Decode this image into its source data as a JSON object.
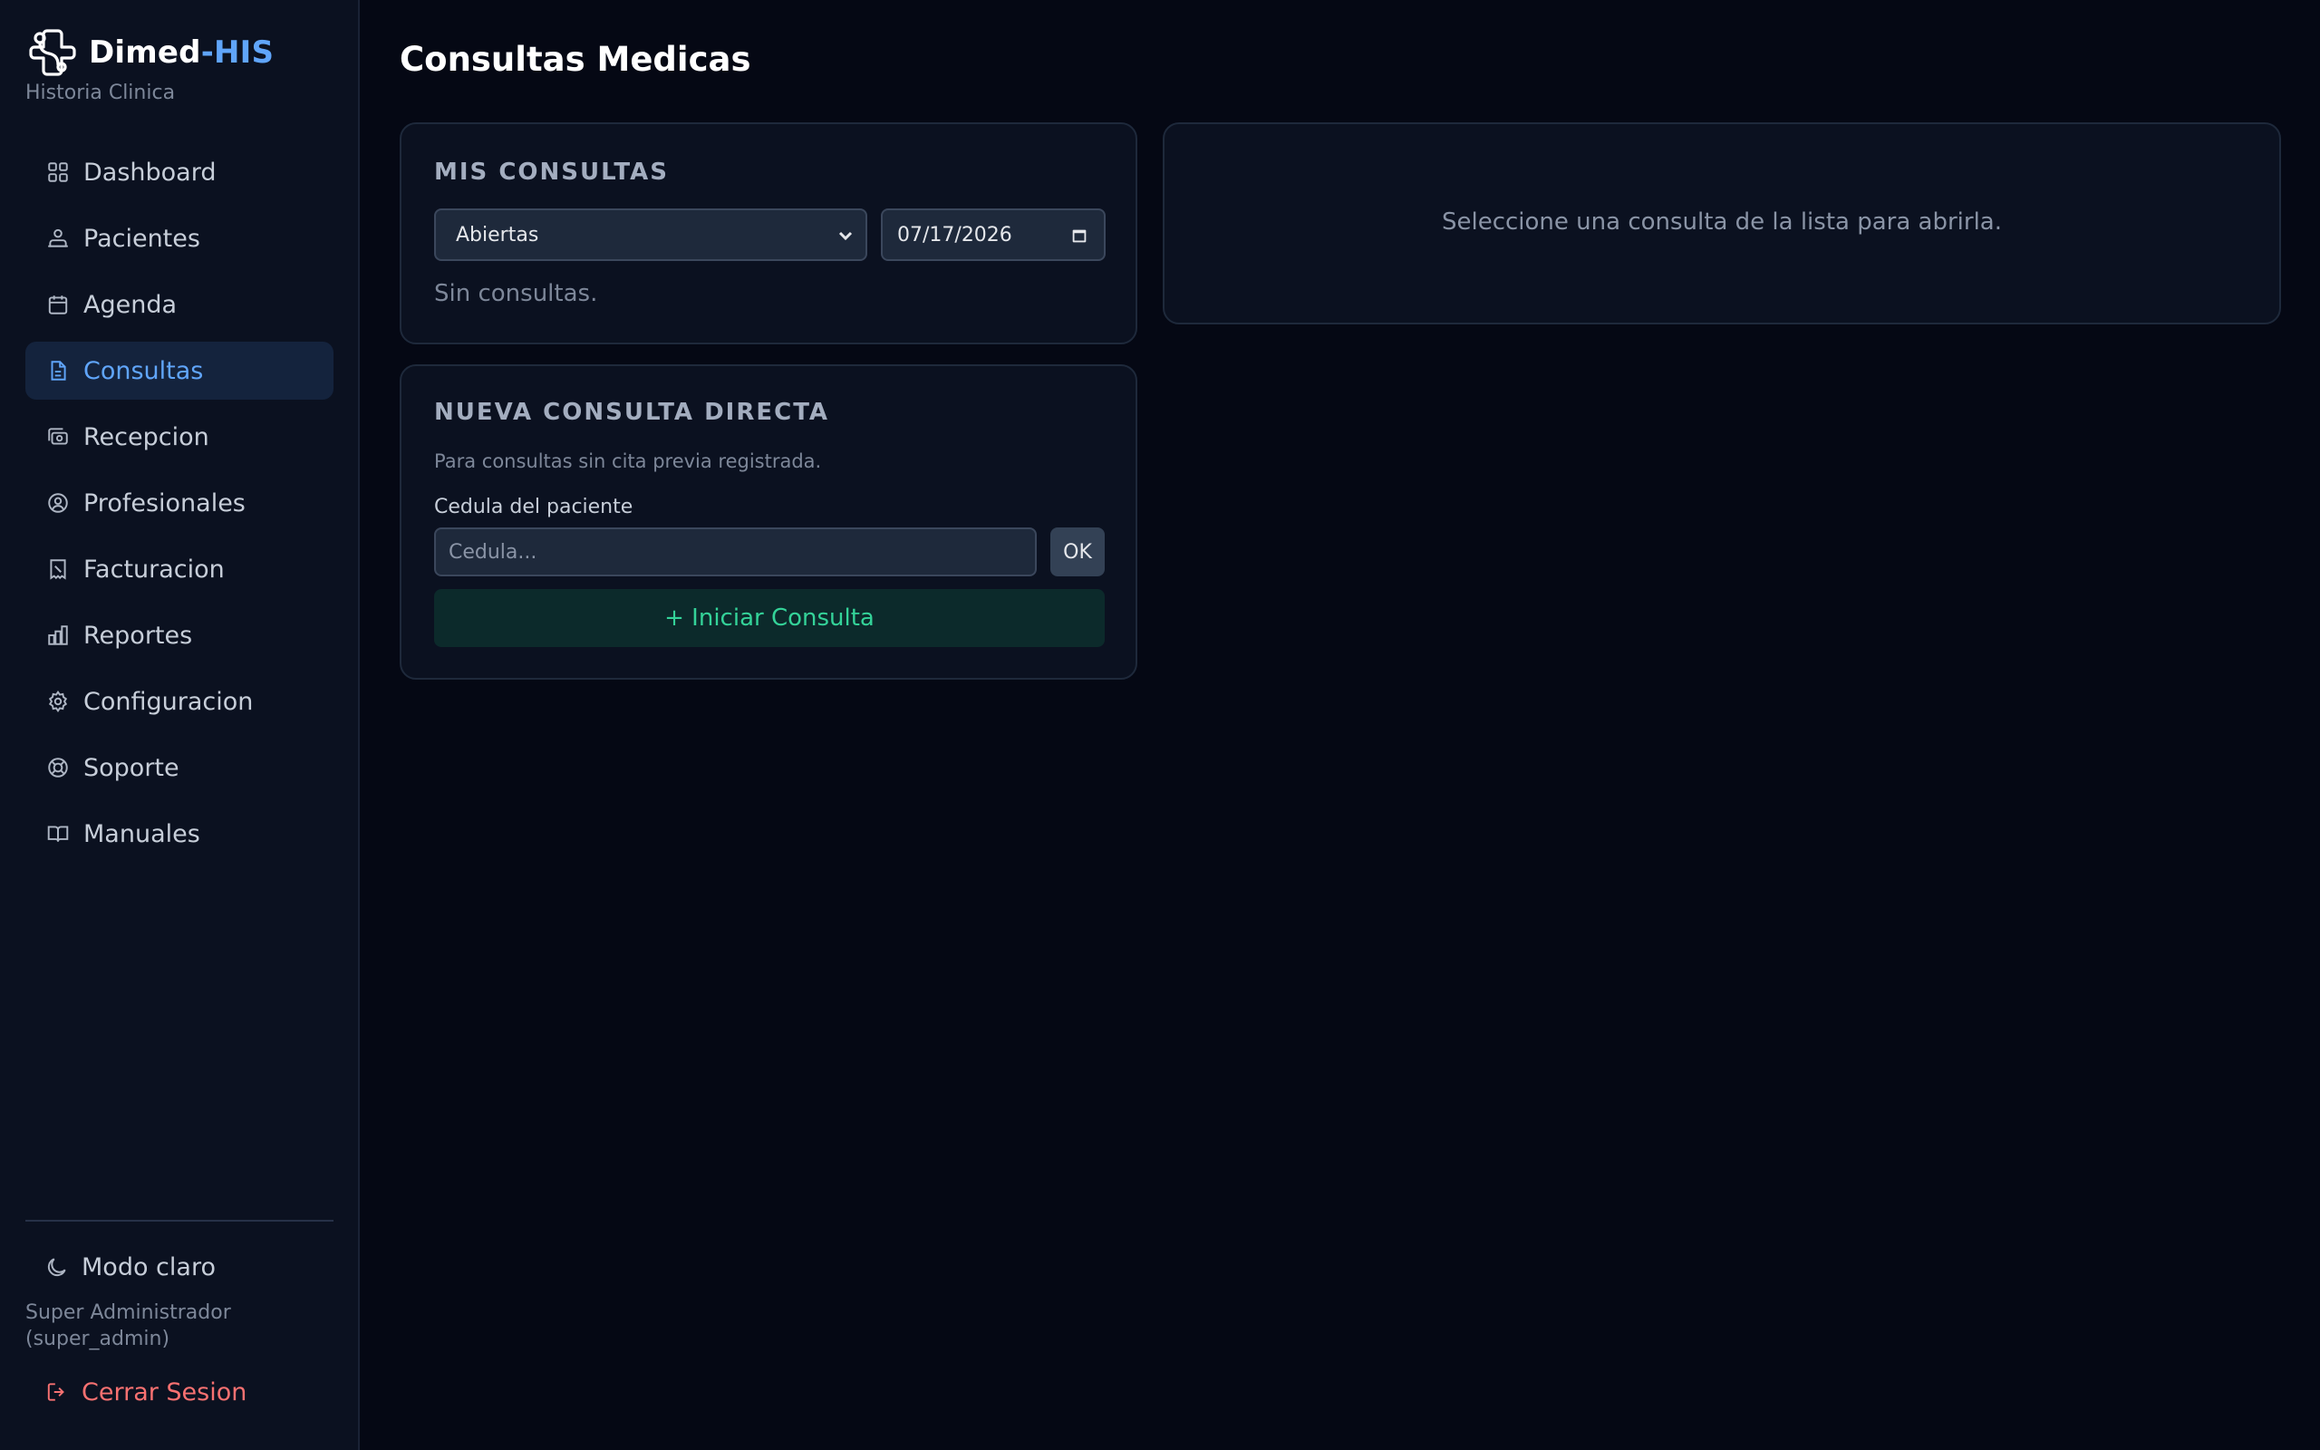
{
  "app": {
    "name_main": "Dimed",
    "name_accent": "-HIS",
    "subtitle": "Historia Clinica"
  },
  "sidebar": {
    "items": [
      {
        "label": "Dashboard",
        "icon": "grid-icon"
      },
      {
        "label": "Pacientes",
        "icon": "patients-icon"
      },
      {
        "label": "Agenda",
        "icon": "calendar-icon"
      },
      {
        "label": "Consultas",
        "icon": "document-icon",
        "active": true
      },
      {
        "label": "Recepcion",
        "icon": "reception-icon"
      },
      {
        "label": "Profesionales",
        "icon": "user-circle-icon"
      },
      {
        "label": "Facturacion",
        "icon": "receipt-icon"
      },
      {
        "label": "Reportes",
        "icon": "bar-chart-icon"
      },
      {
        "label": "Configuracion",
        "icon": "gear-icon"
      },
      {
        "label": "Soporte",
        "icon": "support-icon"
      },
      {
        "label": "Manuales",
        "icon": "book-icon"
      }
    ],
    "theme_toggle": "Modo claro",
    "user_line1": "Super Administrador",
    "user_line2": "(super_admin)",
    "logout": "Cerrar Sesion"
  },
  "page": {
    "title": "Consultas Medicas"
  },
  "mis_consultas": {
    "heading": "MIS CONSULTAS",
    "filter_value": "Abiertas",
    "date_value": "07/17/2026",
    "empty_text": "Sin consultas."
  },
  "nueva_consulta": {
    "heading": "NUEVA CONSULTA DIRECTA",
    "description": "Para consultas sin cita previa registrada.",
    "field_label": "Cedula del paciente",
    "field_placeholder": "Cedula...",
    "ok_label": "OK",
    "start_label": "+ Iniciar Consulta"
  },
  "detail": {
    "empty_message": "Seleccione una consulta de la lista para abrirla."
  },
  "colors": {
    "accent": "#60a5fa",
    "danger": "#f87171",
    "success": "#34d399",
    "background": "#050814",
    "sidebar": "#0b1120"
  }
}
